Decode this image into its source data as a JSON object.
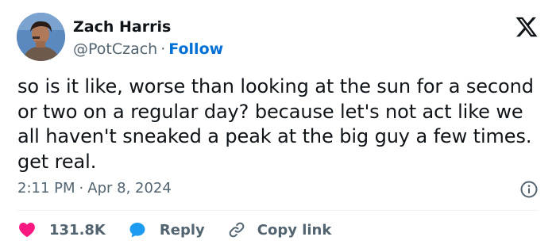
{
  "author": {
    "name": "Zach Harris",
    "handle": "@PotCzach",
    "separator": "·",
    "follow_label": "Follow"
  },
  "tweet": {
    "text": "so is it like, worse than looking at the sun for a second or two on a regular day? because let's not act like we all haven't sneaked a peak at the big guy a few times. get real.",
    "time": "2:11 PM",
    "separator": "·",
    "date": "Apr 8, 2024"
  },
  "actions": {
    "likes_count": "131.8K",
    "reply_label": "Reply",
    "copy_label": "Copy link"
  },
  "icons": {
    "logo": "x-logo-icon",
    "info": "info-icon",
    "like": "heart-icon",
    "reply": "speech-bubble-icon",
    "copy": "link-icon"
  },
  "colors": {
    "text": "#0f1419",
    "muted": "#536471",
    "follow": "#006fd6",
    "heart": "#f91880",
    "reply": "#1d9bf0",
    "divider": "#eff3f4"
  }
}
